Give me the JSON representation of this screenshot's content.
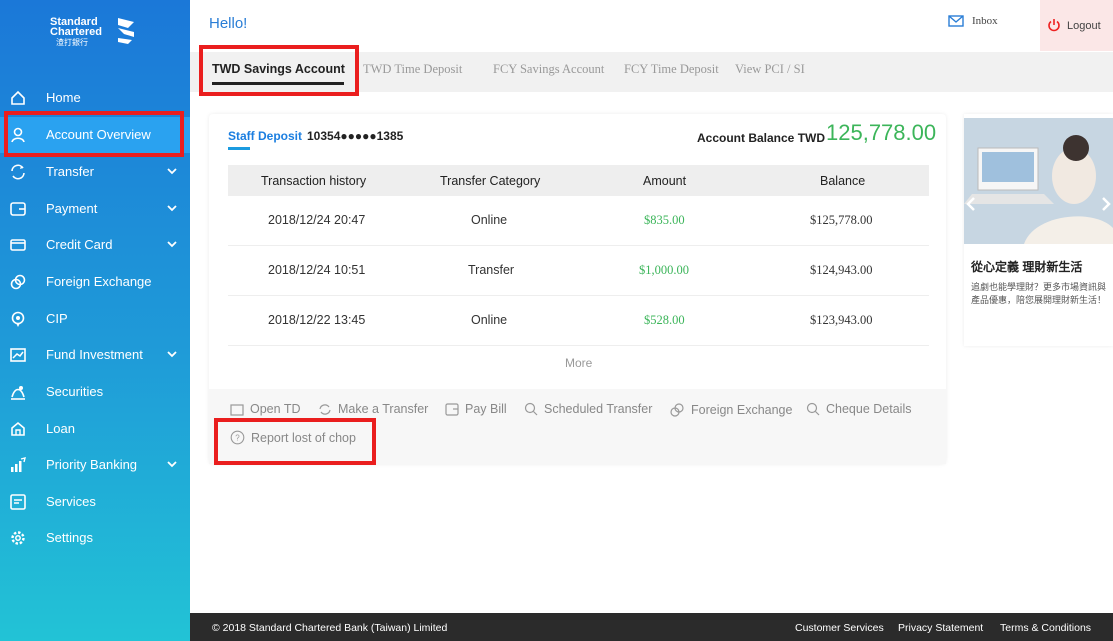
{
  "brand": {
    "line1": "Standard",
    "line2": "Chartered",
    "line3": "渣打銀行"
  },
  "header": {
    "greeting": "Hello!",
    "inbox_label": "Inbox",
    "logout_label": "Logout"
  },
  "sidebar": {
    "items": [
      {
        "label": "Home",
        "icon": "home-icon"
      },
      {
        "label": "Account Overview",
        "icon": "user-icon",
        "active": true
      },
      {
        "label": "Transfer",
        "icon": "transfer-icon",
        "expandable": true
      },
      {
        "label": "Payment",
        "icon": "wallet-icon",
        "expandable": true
      },
      {
        "label": "Credit Card",
        "icon": "credit-card-icon",
        "expandable": true
      },
      {
        "label": "Foreign Exchange",
        "icon": "exchange-icon"
      },
      {
        "label": "CIP",
        "icon": "badge-icon"
      },
      {
        "label": "Fund Investment",
        "icon": "chart-icon",
        "expandable": true
      },
      {
        "label": "Securities",
        "icon": "securities-icon"
      },
      {
        "label": "Loan",
        "icon": "loan-icon"
      },
      {
        "label": "Priority Banking",
        "icon": "priority-icon",
        "expandable": true
      },
      {
        "label": "Services",
        "icon": "services-icon"
      },
      {
        "label": "Settings",
        "icon": "gear-icon"
      }
    ]
  },
  "tabs": [
    {
      "label": "TWD Savings Account",
      "active": true
    },
    {
      "label": "TWD Time Deposit"
    },
    {
      "label": "FCY Savings Account"
    },
    {
      "label": "FCY Time Deposit"
    },
    {
      "label": "View PCI / SI"
    }
  ],
  "account": {
    "type_label": "Staff Deposit",
    "number": "10354●●●●●1385",
    "balance_label": "Account Balance TWD",
    "balance_value": "125,778.00"
  },
  "table": {
    "headers": [
      "Transaction history",
      "Transfer Category",
      "Amount",
      "Balance"
    ],
    "rows": [
      [
        "2018/12/24 20:47",
        "Online",
        "$835.00",
        "$125,778.00"
      ],
      [
        "2018/12/24 10:51",
        "Transfer",
        "$1,000.00",
        "$124,943.00"
      ],
      [
        "2018/12/22 13:45",
        "Online",
        "$528.00",
        "$123,943.00"
      ]
    ],
    "more_label": "More"
  },
  "actions": {
    "open_td": "Open TD",
    "make_transfer": "Make a Transfer",
    "pay_bill": "Pay Bill",
    "scheduled_transfer": "Scheduled Transfer",
    "foreign_exchange": "Foreign Exchange",
    "cheque_details": "Cheque Details",
    "report_lost_chop": "Report lost of chop"
  },
  "ad": {
    "title": "從心定義 理財新生活",
    "description": "追劇也能學理財？更多市場資訊與產品優惠，陪您展開理財新生活！"
  },
  "footer": {
    "copyright": "© 2018 Standard Chartered Bank (Taiwan) Limited",
    "customer_services": "Customer Services",
    "privacy": "Privacy Statement",
    "terms": "Terms & Conditions"
  },
  "colors": {
    "accent_blue": "#1b7ee0",
    "positive_green": "#3cb55a",
    "highlight_red": "#ea1e1e",
    "footer_bg": "#2b2b2b"
  }
}
